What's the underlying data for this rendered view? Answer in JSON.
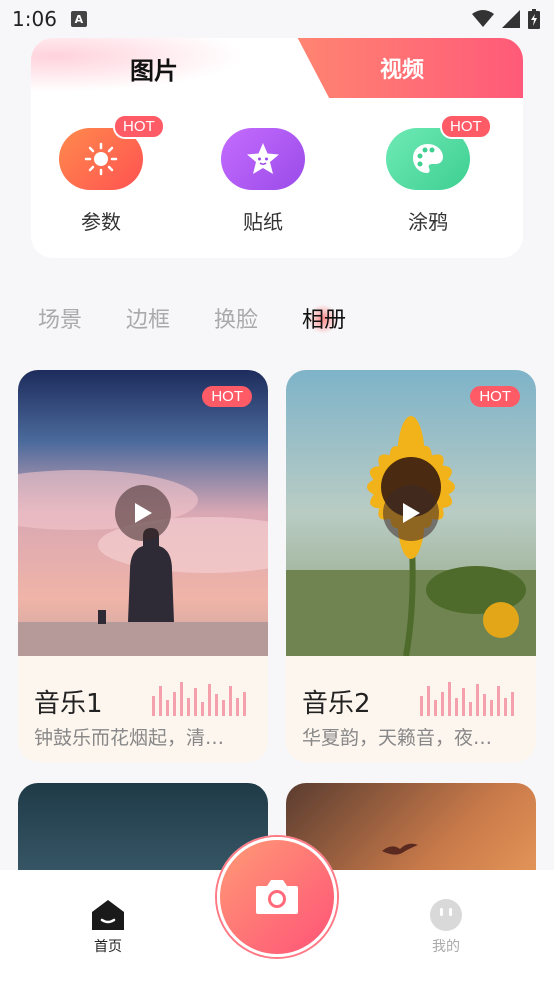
{
  "status": {
    "time": "1:06"
  },
  "media_tabs": {
    "photo": "图片",
    "video": "视频"
  },
  "tools": [
    {
      "label": "参数",
      "hot": "HOT",
      "icon": "sun-icon",
      "color": "#ff6a4d"
    },
    {
      "label": "贴纸",
      "hot": "",
      "icon": "star-face-icon",
      "color": "#b45cf0"
    },
    {
      "label": "涂鸦",
      "hot": "HOT",
      "icon": "palette-icon",
      "color": "#4fdca2"
    }
  ],
  "categories": [
    "场景",
    "边框",
    "换脸",
    "相册"
  ],
  "active_category": "相册",
  "cards": [
    {
      "title": "音乐1",
      "desc": "钟鼓乐而花烟起，清…",
      "badge": "HOT"
    },
    {
      "title": "音乐2",
      "desc": "华夏韵，天籁音，夜…",
      "badge": "HOT"
    }
  ],
  "nav": {
    "home": "首页",
    "mine": "我的"
  },
  "colors": {
    "accent": "#ff5b67",
    "gradient_start": "#ff9a76",
    "gradient_end": "#ff5377"
  }
}
